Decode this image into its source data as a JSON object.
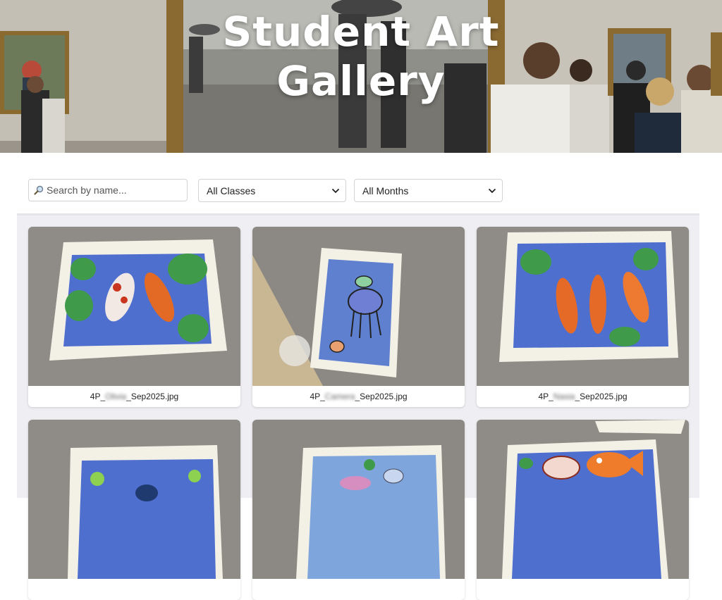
{
  "hero": {
    "title_line1": "Student Art",
    "title_line2": "Gallery"
  },
  "filters": {
    "search_placeholder": "Search by name...",
    "class_select": {
      "selected": "All Classes"
    },
    "month_select": {
      "selected": "All Months"
    }
  },
  "gallery": {
    "items": [
      {
        "prefix": "4P_",
        "name": "Olivia",
        "suffix": "_Sep2025.jpg",
        "subject": "koi-fish"
      },
      {
        "prefix": "4P_",
        "name": "Camera",
        "suffix": "_Sep2025.jpg",
        "subject": "jellyfish"
      },
      {
        "prefix": "4P_",
        "name": "Nasia",
        "suffix": "_Sep2025.jpg",
        "subject": "koi-fish"
      },
      {
        "prefix": "",
        "name": "",
        "suffix": "",
        "subject": "pond"
      },
      {
        "prefix": "",
        "name": "",
        "suffix": "",
        "subject": "jellyfish"
      },
      {
        "prefix": "",
        "name": "",
        "suffix": "",
        "subject": "fish"
      }
    ]
  },
  "colors": {
    "grid_background": "#efeff3",
    "card_background": "#ffffff",
    "title": "#ffffff"
  }
}
